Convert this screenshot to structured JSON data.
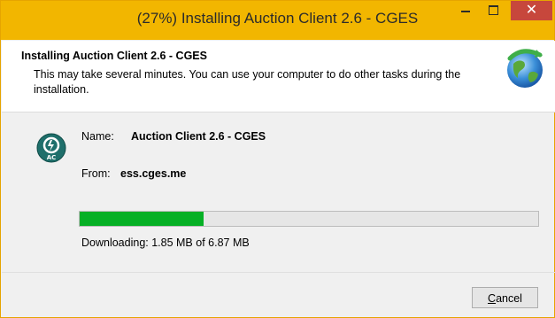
{
  "window": {
    "title": "(27%) Installing Auction Client 2.6 - CGES",
    "close_glyph": "✕",
    "accent_color": "#f2b600"
  },
  "header": {
    "title": "Installing Auction Client 2.6 - CGES",
    "description": "This may take several minutes. You can use your computer to do other tasks during the installation.",
    "icon": "globe-install-icon"
  },
  "details": {
    "app_icon": "auction-client-icon",
    "app_icon_text": "AC",
    "name_label": "Name:",
    "name_value": "Auction Client 2.6 - CGES",
    "from_label": "From:",
    "from_value": "ess.cges.me"
  },
  "progress": {
    "percent": 27,
    "status_text": "Downloading: 1.85 MB of 6.87 MB",
    "fill_color": "#06b025"
  },
  "footer": {
    "cancel_accel": "C",
    "cancel_rest": "ancel"
  }
}
